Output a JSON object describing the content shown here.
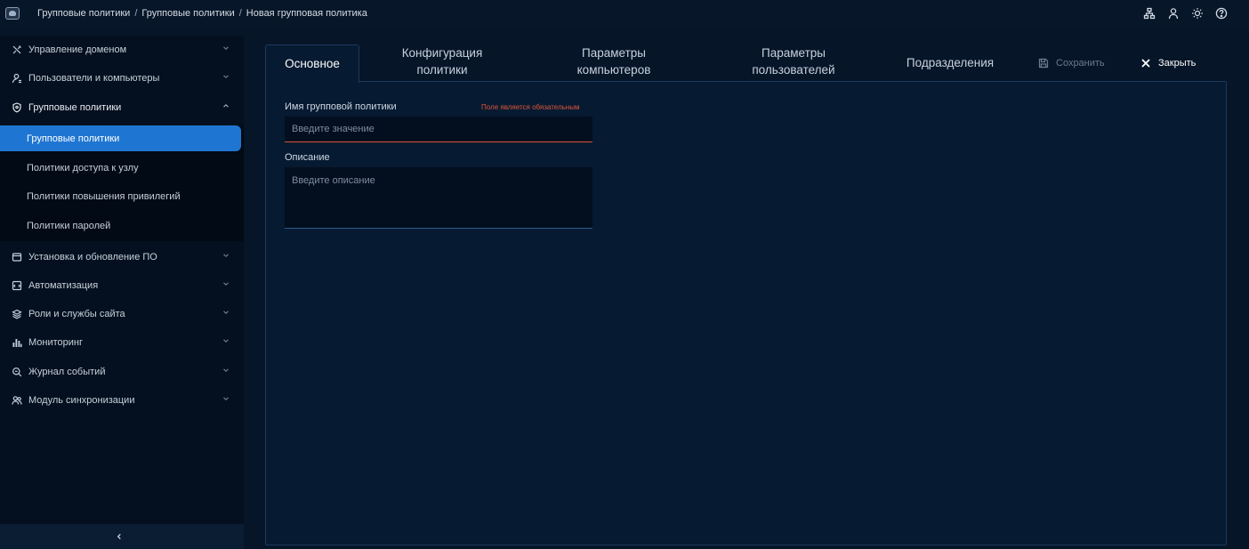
{
  "breadcrumb": [
    "Групповые политики",
    "Групповые политики",
    "Новая групповая политика"
  ],
  "top_icons": [
    "network-icon",
    "user-icon",
    "theme-sun-icon",
    "help-icon"
  ],
  "sidebar": {
    "items": [
      {
        "label": "Управление доменом",
        "icon": "tools-icon"
      },
      {
        "label": "Пользователи и компьютеры",
        "icon": "user-icon"
      },
      {
        "label": "Групповые политики",
        "icon": "shield-icon"
      },
      {
        "label": "Установка и обновление ПО",
        "icon": "window-icon"
      },
      {
        "label": "Автоматизация",
        "icon": "script-icon"
      },
      {
        "label": "Роли и службы сайта",
        "icon": "layers-icon"
      },
      {
        "label": "Мониторинг",
        "icon": "bar-chart-icon"
      },
      {
        "label": "Журнал событий",
        "icon": "search-log-icon"
      },
      {
        "label": "Модуль синхронизации",
        "icon": "users-sync-icon"
      }
    ],
    "sub_items": [
      {
        "label": "Групповые политики",
        "active": true
      },
      {
        "label": "Политики доступа к узлу",
        "active": false
      },
      {
        "label": "Политики повышения привилегий",
        "active": false
      },
      {
        "label": "Политики паролей",
        "active": false
      }
    ]
  },
  "tabs": [
    {
      "line1": "Основное",
      "line2": ""
    },
    {
      "line1": "Конфигурация",
      "line2": "политики"
    },
    {
      "line1": "Параметры",
      "line2": "компьютеров"
    },
    {
      "line1": "Параметры",
      "line2": "пользователей"
    },
    {
      "line1": "Подразделения",
      "line2": ""
    }
  ],
  "actions": {
    "save": "Сохранить",
    "close": "Закрыть"
  },
  "form": {
    "name_label": "Имя групповой политики",
    "required_note": "Поле является обязательным",
    "name_placeholder": "Введите значение",
    "name_value": "",
    "description_label": "Описание",
    "description_placeholder": "Введите описание",
    "description_value": ""
  },
  "colors": {
    "accent": "#1f76d2",
    "error": "#e0573b",
    "background": "#061528"
  }
}
